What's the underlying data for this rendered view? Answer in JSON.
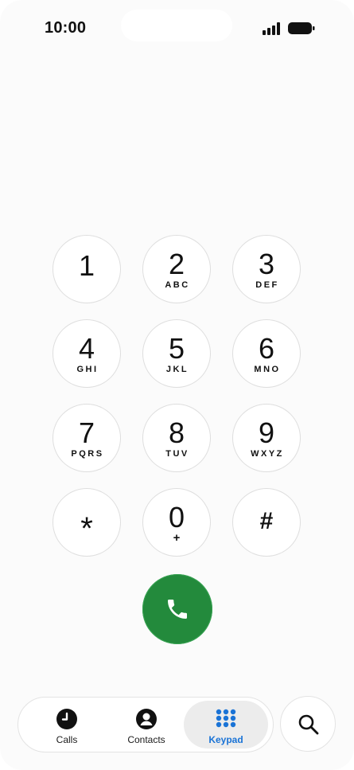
{
  "status_bar": {
    "time": "10:00"
  },
  "keypad": {
    "keys": [
      {
        "digit": "1",
        "letters": ""
      },
      {
        "digit": "2",
        "letters": "ABC"
      },
      {
        "digit": "3",
        "letters": "DEF"
      },
      {
        "digit": "4",
        "letters": "GHI"
      },
      {
        "digit": "5",
        "letters": "JKL"
      },
      {
        "digit": "6",
        "letters": "MNO"
      },
      {
        "digit": "7",
        "letters": "PQRS"
      },
      {
        "digit": "8",
        "letters": "TUV"
      },
      {
        "digit": "9",
        "letters": "WXYZ"
      },
      {
        "digit": "*",
        "letters": ""
      },
      {
        "digit": "0",
        "letters": "+"
      },
      {
        "digit": "#",
        "letters": ""
      }
    ]
  },
  "call_button": {
    "icon": "phone-icon",
    "color": "#238a3c"
  },
  "tab_bar": {
    "tabs": [
      {
        "label": "Calls",
        "icon": "clock-icon",
        "active": false
      },
      {
        "label": "Contacts",
        "icon": "person-circle-icon",
        "active": false
      },
      {
        "label": "Keypad",
        "icon": "keypad-grid-icon",
        "active": true
      }
    ],
    "active_color": "#1a73d6"
  },
  "search": {
    "icon": "search-icon"
  }
}
